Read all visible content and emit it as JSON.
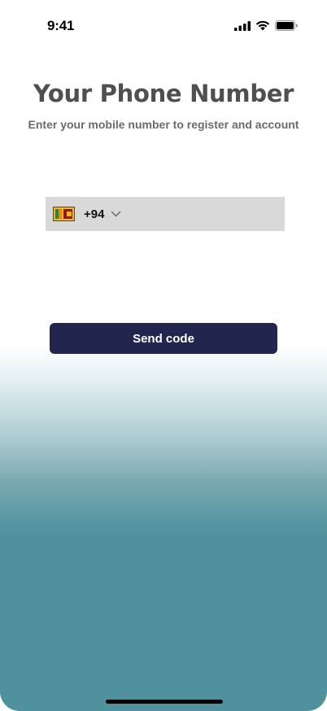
{
  "status_bar": {
    "time": "9:41",
    "icons": [
      "cellular-signal-icon",
      "wifi-icon",
      "battery-icon"
    ]
  },
  "header": {
    "title": "Your Phone Number",
    "subtitle": "Enter your mobile number to register and account"
  },
  "phone_input": {
    "country_flag": "sri-lanka-flag-icon",
    "dial_code": "+94",
    "dropdown_icon": "chevron-down-icon",
    "value": "",
    "placeholder": ""
  },
  "send_button": {
    "label": "Send code"
  },
  "colors": {
    "title": "#4f4f4f",
    "subtitle": "#6b6b6b",
    "input_background": "#d9d9d9",
    "button_background": "#22264f",
    "button_text": "#ffffff",
    "gradient_bottom": "#4f929d"
  }
}
